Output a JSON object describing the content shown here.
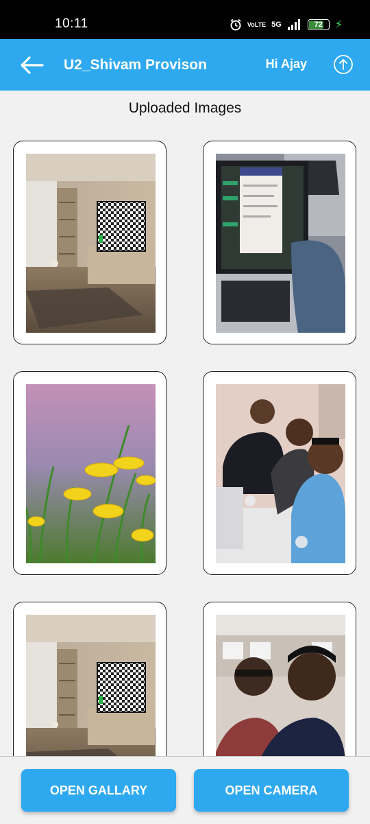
{
  "status_bar": {
    "time": "10:11",
    "network_label": "VoLTE",
    "signal_label": "5G",
    "battery_level": "72",
    "battery_fraction": 0.72
  },
  "app_bar": {
    "title": "U2_Shivam Provison",
    "greeting": "Hi Ajay",
    "back_icon": "arrow-left-icon",
    "upload_icon": "upload-icon"
  },
  "section": {
    "title": "Uploaded Images"
  },
  "images": [
    {
      "scene": "living-room-tv"
    },
    {
      "scene": "laptop-screen"
    },
    {
      "scene": "yellow-flowers"
    },
    {
      "scene": "group-selfie"
    },
    {
      "scene": "living-room-tv"
    },
    {
      "scene": "office-selfie"
    }
  ],
  "actions": {
    "gallery_label": "OPEN GALLARY",
    "camera_label": "OPEN CAMERA"
  },
  "colors": {
    "accent": "#2ea9f0",
    "background": "#f1f1f1"
  }
}
